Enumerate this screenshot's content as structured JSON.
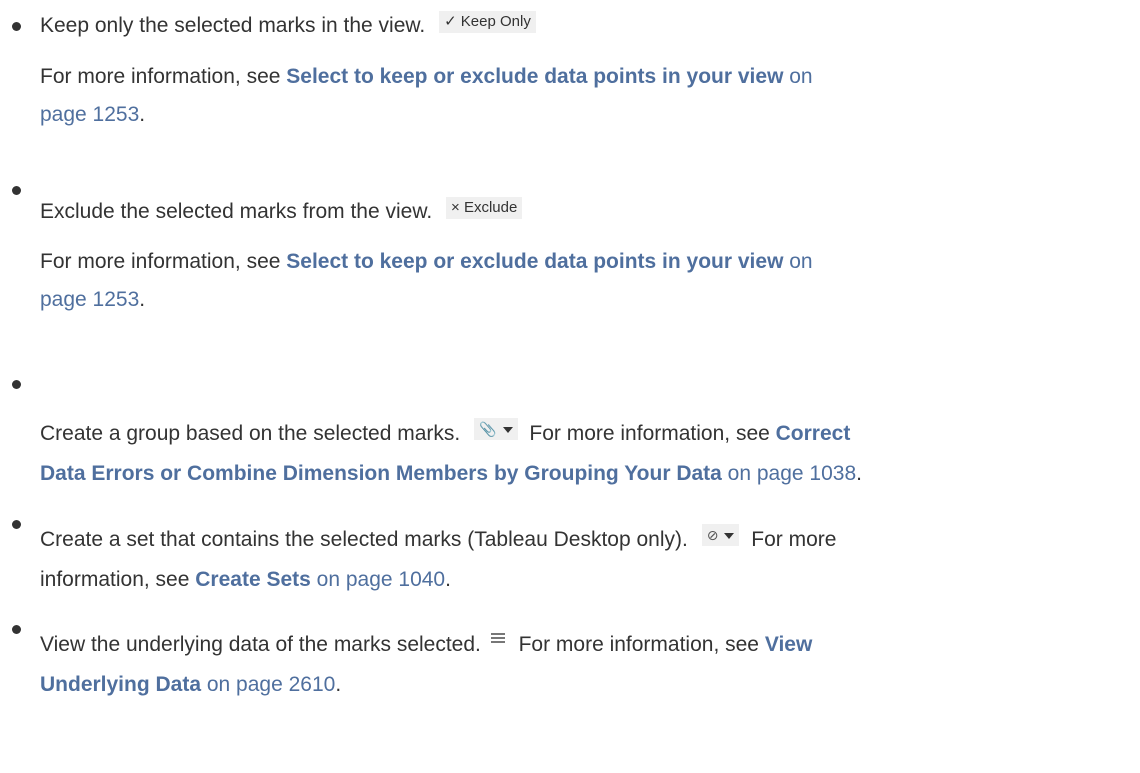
{
  "items": [
    {
      "text": "Keep only the selected marks in the view.",
      "button_label": "✓ Keep Only",
      "info_prefix": "For more information, see ",
      "info_link": "Select to keep or exclude data points in your view",
      "info_page_prefix": " on",
      "info_page": "page 1253",
      "info_end": "."
    },
    {
      "text": "Exclude the selected marks from the view.",
      "button_label": "× Exclude",
      "info_prefix": "For more information, see ",
      "info_link": "Select to keep or exclude data points in your view",
      "info_page_prefix": " on",
      "info_page": "page 1253",
      "info_end": "."
    },
    {
      "text": "Create a group based on the selected marks.",
      "icon": "paperclip-dropdown-icon",
      "after_icon": "For more information, see ",
      "link_part1": "Correct",
      "link_part2": "Data Errors or Combine Dimension Members by Grouping Your Data",
      "page_text": " on page 1038",
      "end": "."
    },
    {
      "text": "Create a set that contains the selected marks (Tableau Desktop only).",
      "icon": "set-dropdown-icon",
      "after_icon": "For more",
      "line2_prefix": "information, see ",
      "link": "Create Sets",
      "page_text": " on page 1040",
      "end": "."
    },
    {
      "text": "View the underlying data of the marks selected.",
      "icon": "view-data-icon",
      "after_icon": "For more information, see ",
      "link_part1": "View",
      "link_part2": "Underlying Data",
      "page_text": " on page 2610",
      "end": "."
    }
  ]
}
